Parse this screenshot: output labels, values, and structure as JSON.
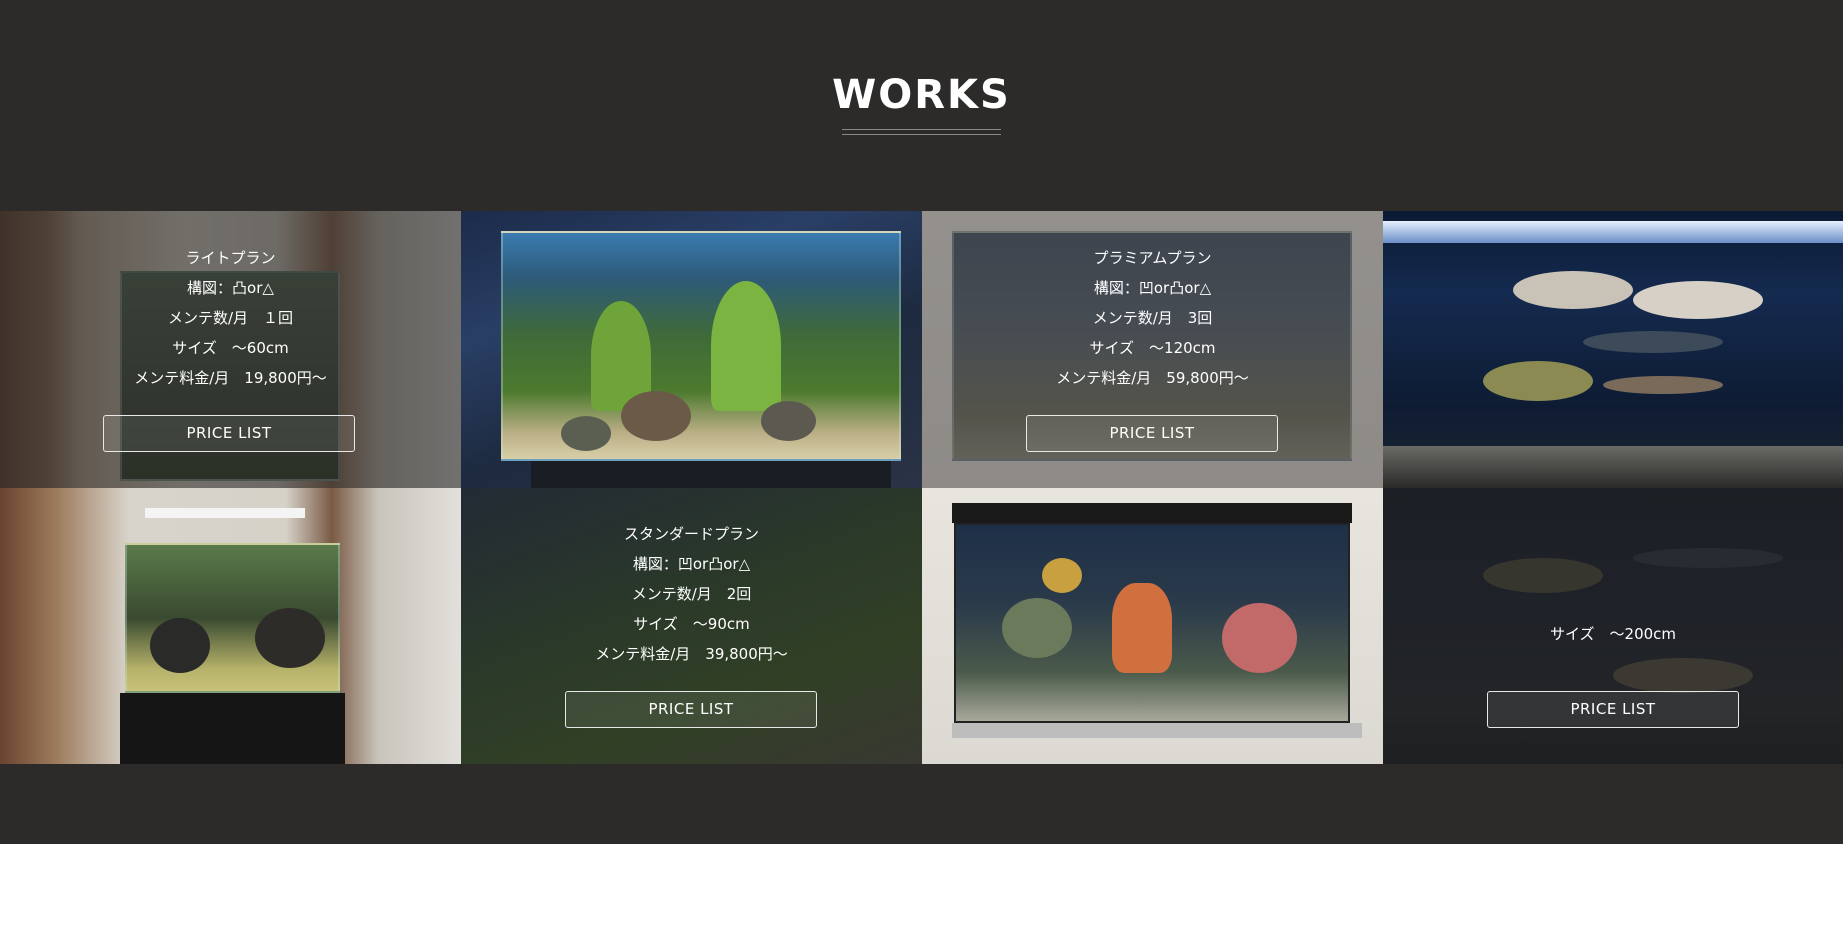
{
  "section": {
    "title": "WORKS"
  },
  "plans": {
    "light": {
      "name": "ライトプラン",
      "layout": "構図：凸or△",
      "visits": "メンテ数/月　１回",
      "size": "サイズ　〜60cm",
      "price": "メンテ料金/月　19,800円〜",
      "button": "PRICE LIST"
    },
    "standard": {
      "name": "スタンダードプラン",
      "layout": "構図：凹or凸or△",
      "visits": "メンテ数/月　2回",
      "size": "サイズ　〜90cm",
      "price": "メンテ料金/月　39,800円〜",
      "button": "PRICE LIST"
    },
    "premium": {
      "name": "プラミアムプラン",
      "layout": "構図：凹or凸or△",
      "visits": "メンテ数/月　3回",
      "size": "サイズ　〜120cm",
      "price": "メンテ料金/月　59,800円〜",
      "button": "PRICE LIST"
    },
    "large": {
      "size": "サイズ　〜200cm",
      "button": "PRICE LIST"
    }
  },
  "colors": {
    "section_bg": "#2d2b29",
    "text": "#ffffff"
  }
}
